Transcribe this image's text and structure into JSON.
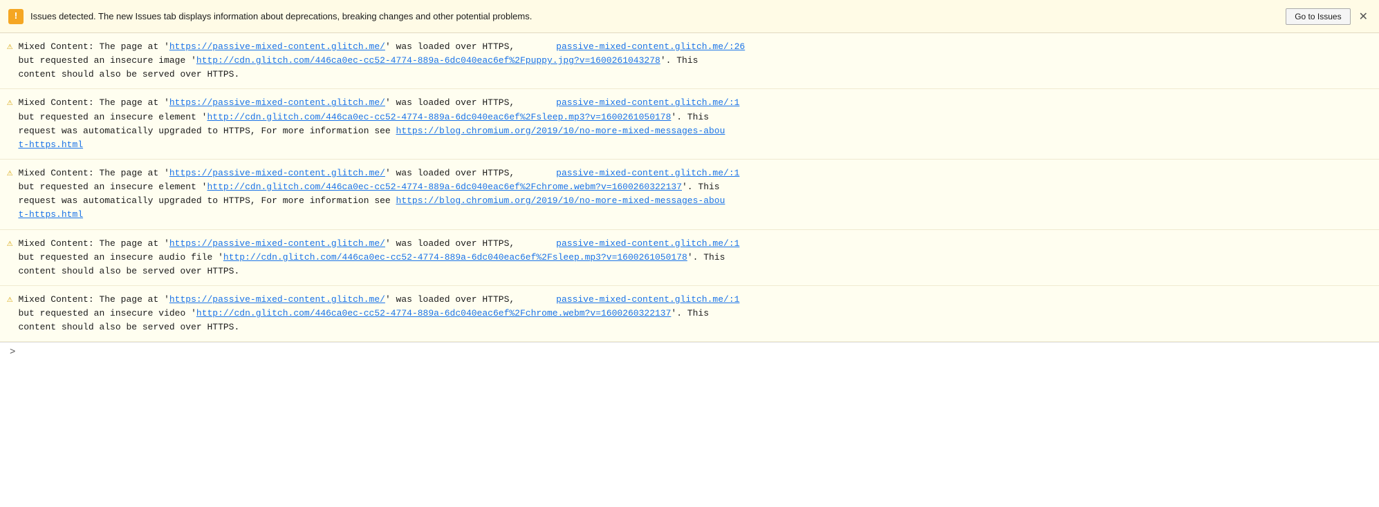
{
  "topbar": {
    "warning_icon": "!",
    "message": "Issues detected. The new Issues tab displays information about deprecations, breaking changes and other potential problems.",
    "go_to_issues_label": "Go to Issues",
    "close_label": "✕"
  },
  "messages": [
    {
      "id": 1,
      "line1_prefix": "Mixed Content: The page at '",
      "line1_url": "https://passive-mixed-content.glitch.me/",
      "line1_suffix": "' was loaded over HTTPS,",
      "line1_right_link": "passive-mixed-content.glitch.me/:26",
      "line2_prefix": "but requested an insecure image '",
      "line2_url": "http://cdn.glitch.com/446ca0ec-cc52-4774-889a-6dc040eac6ef%2Fpuppy.jpg?v=1600261043278",
      "line2_suffix": "'. This",
      "line3": "content should also be served over HTTPS."
    },
    {
      "id": 2,
      "line1_prefix": "Mixed Content: The page at '",
      "line1_url": "https://passive-mixed-content.glitch.me/",
      "line1_suffix": "' was loaded over HTTPS,",
      "line1_right_link": "passive-mixed-content.glitch.me/:1",
      "line2_prefix": "but requested an insecure element '",
      "line2_url": "http://cdn.glitch.com/446ca0ec-cc52-4774-889a-6dc040eac6ef%2Fsleep.mp3?v=1600261050178",
      "line2_suffix": "'. This",
      "line3_prefix": "request was automatically upgraded to HTTPS, For more information see ",
      "line3_url": "https://blog.chromium.org/2019/10/no-more-mixed-messages-about-https.html",
      "line3_url_display": "https://blog.chromium.org/2019/10/no-more-mixed-messages-abou\nt-https.html"
    },
    {
      "id": 3,
      "line1_prefix": "Mixed Content: The page at '",
      "line1_url": "https://passive-mixed-content.glitch.me/",
      "line1_suffix": "' was loaded over HTTPS,",
      "line1_right_link": "passive-mixed-content.glitch.me/:1",
      "line2_prefix": "but requested an insecure element '",
      "line2_url": "http://cdn.glitch.com/446ca0ec-cc52-4774-889a-6dc040eac6ef%2Fchrome.webm?v=1600260322137",
      "line2_suffix": "'. This",
      "line3_prefix": "request was automatically upgraded to HTTPS, For more information see ",
      "line3_url": "https://blog.chromium.org/2019/10/no-more-mixed-messages-about-https.html",
      "line3_url_display": "https://blog.chromium.org/2019/10/no-more-mixed-messages-abou\nt-https.html"
    },
    {
      "id": 4,
      "line1_prefix": "Mixed Content: The page at '",
      "line1_url": "https://passive-mixed-content.glitch.me/",
      "line1_suffix": "' was loaded over HTTPS,",
      "line1_right_link": "passive-mixed-content.glitch.me/:1",
      "line2_prefix": "but requested an insecure audio file '",
      "line2_url": "http://cdn.glitch.com/446ca0ec-cc52-4774-889a-6dc040eac6ef%2Fsleep.mp3?v=1600261050178",
      "line2_suffix": "'. This",
      "line3": "content should also be served over HTTPS."
    },
    {
      "id": 5,
      "line1_prefix": "Mixed Content: The page at '",
      "line1_url": "https://passive-mixed-content.glitch.me/",
      "line1_suffix": "' was loaded over HTTPS,",
      "line1_right_link": "passive-mixed-content.glitch.me/:1",
      "line2_prefix": "but requested an insecure video '",
      "line2_url": "http://cdn.glitch.com/446ca0ec-cc52-4774-889a-6dc040eac6ef%2Fchrome.webm?v=1600260322137",
      "line2_suffix": "'. This",
      "line3": "content should also be served over HTTPS."
    }
  ],
  "bottom": {
    "chevron": ">"
  }
}
